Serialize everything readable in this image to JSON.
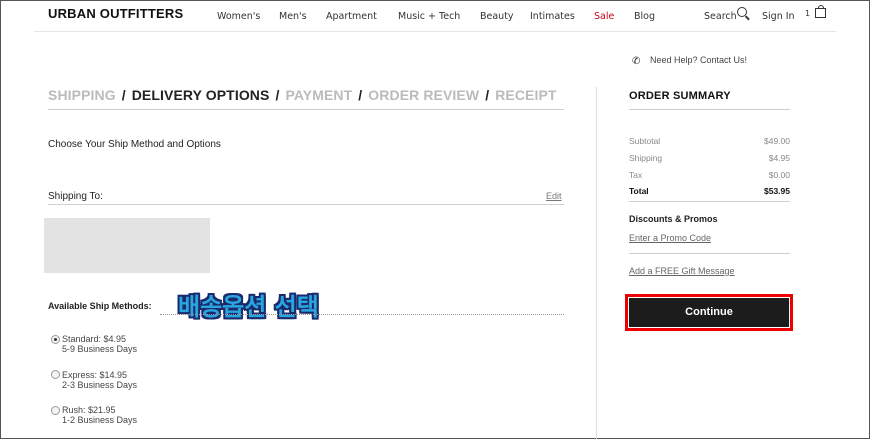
{
  "header": {
    "logo": "URBAN OUTFITTERS",
    "nav": [
      "Women's",
      "Men's",
      "Apartment",
      "Music + Tech",
      "Beauty",
      "Intimates",
      "Sale",
      "Blog"
    ],
    "search_label": "Search",
    "signin_label": "Sign In",
    "bag_count": "1"
  },
  "help": {
    "text": "Need Help? Contact Us!"
  },
  "steps": {
    "shipping": "SHIPPING",
    "delivery": "DELIVERY OPTIONS",
    "payment": "PAYMENT",
    "review": "ORDER REVIEW",
    "receipt": "RECEIPT",
    "separator": "/"
  },
  "main": {
    "intro": "Choose Your Ship Method and Options",
    "shipping_to": "Shipping To:",
    "edit": "Edit",
    "available": "Available Ship Methods:",
    "overlay_text": "배송옵션 선택",
    "methods": [
      {
        "label": "Standard: $4.95",
        "days": "5-9 Business Days",
        "selected": true
      },
      {
        "label": "Express: $14.95",
        "days": "2-3 Business Days",
        "selected": false
      },
      {
        "label": "Rush: $21.95",
        "days": "1-2 Business Days",
        "selected": false
      }
    ]
  },
  "summary": {
    "title": "ORDER SUMMARY",
    "rows": [
      {
        "label": "Subtotal",
        "value": "$49.00"
      },
      {
        "label": "Shipping",
        "value": "$4.95"
      },
      {
        "label": "Tax",
        "value": "$0.00"
      },
      {
        "label": "Total",
        "value": "$53.95"
      }
    ],
    "discounts_title": "Discounts & Promos",
    "promo_link": "Enter a Promo Code",
    "gift_link": "Add a FREE Gift Message",
    "continue": "Continue"
  },
  "colors": {
    "sale": "#d0021b",
    "highlight": "#ee0000",
    "button": "#1c1c1c",
    "overlay": "#29a6e0"
  }
}
